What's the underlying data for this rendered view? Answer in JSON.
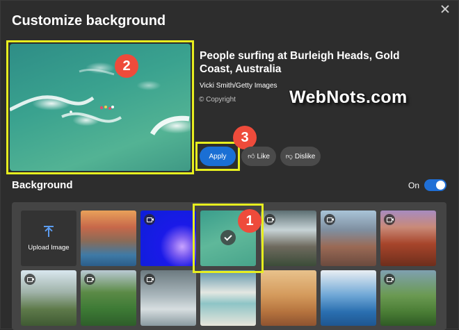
{
  "dialog": {
    "title": "Customize background"
  },
  "preview": {
    "title": "People surfing at Burleigh Heads, Gold Coast, Australia",
    "credit": "Vicki Smith/Getty Images",
    "copyright": "© Copyright",
    "apply_label": "Apply",
    "like_label": "Like",
    "dislike_label": "Dislike"
  },
  "annotations": {
    "badge_1": "1",
    "badge_2": "2",
    "badge_3": "3",
    "watermark": "WebNots.com"
  },
  "background_section": {
    "title": "Background",
    "toggle_label": "On",
    "toggle_on": true,
    "upload_label": "Upload Image",
    "thumbnails": [
      {
        "subject": "sea cliffs arch at sunset",
        "video": false,
        "selected": false
      },
      {
        "subject": "jellyfish on blue",
        "video": true,
        "selected": false
      },
      {
        "subject": "surfers in green sea",
        "video": false,
        "selected": true
      },
      {
        "subject": "waterfall gorge",
        "video": true,
        "selected": false
      },
      {
        "subject": "coastal town",
        "video": true,
        "selected": false
      },
      {
        "subject": "red canyon",
        "video": true,
        "selected": false
      },
      {
        "subject": "mountain ridges",
        "video": true,
        "selected": false
      },
      {
        "subject": "green valley",
        "video": true,
        "selected": false
      },
      {
        "subject": "misty peaks",
        "video": true,
        "selected": false
      },
      {
        "subject": "sand dunes and lagoons",
        "video": false,
        "selected": false
      },
      {
        "subject": "camel caravan in desert",
        "video": false,
        "selected": false
      },
      {
        "subject": "iceberg with birds",
        "video": false,
        "selected": false
      },
      {
        "subject": "green hills",
        "video": true,
        "selected": false
      }
    ]
  },
  "colors": {
    "accent": "#1a6fd4",
    "highlight_frame": "#e7ee1f",
    "badge": "#ee4b3b",
    "dialog_bg": "#2d2d2d"
  }
}
